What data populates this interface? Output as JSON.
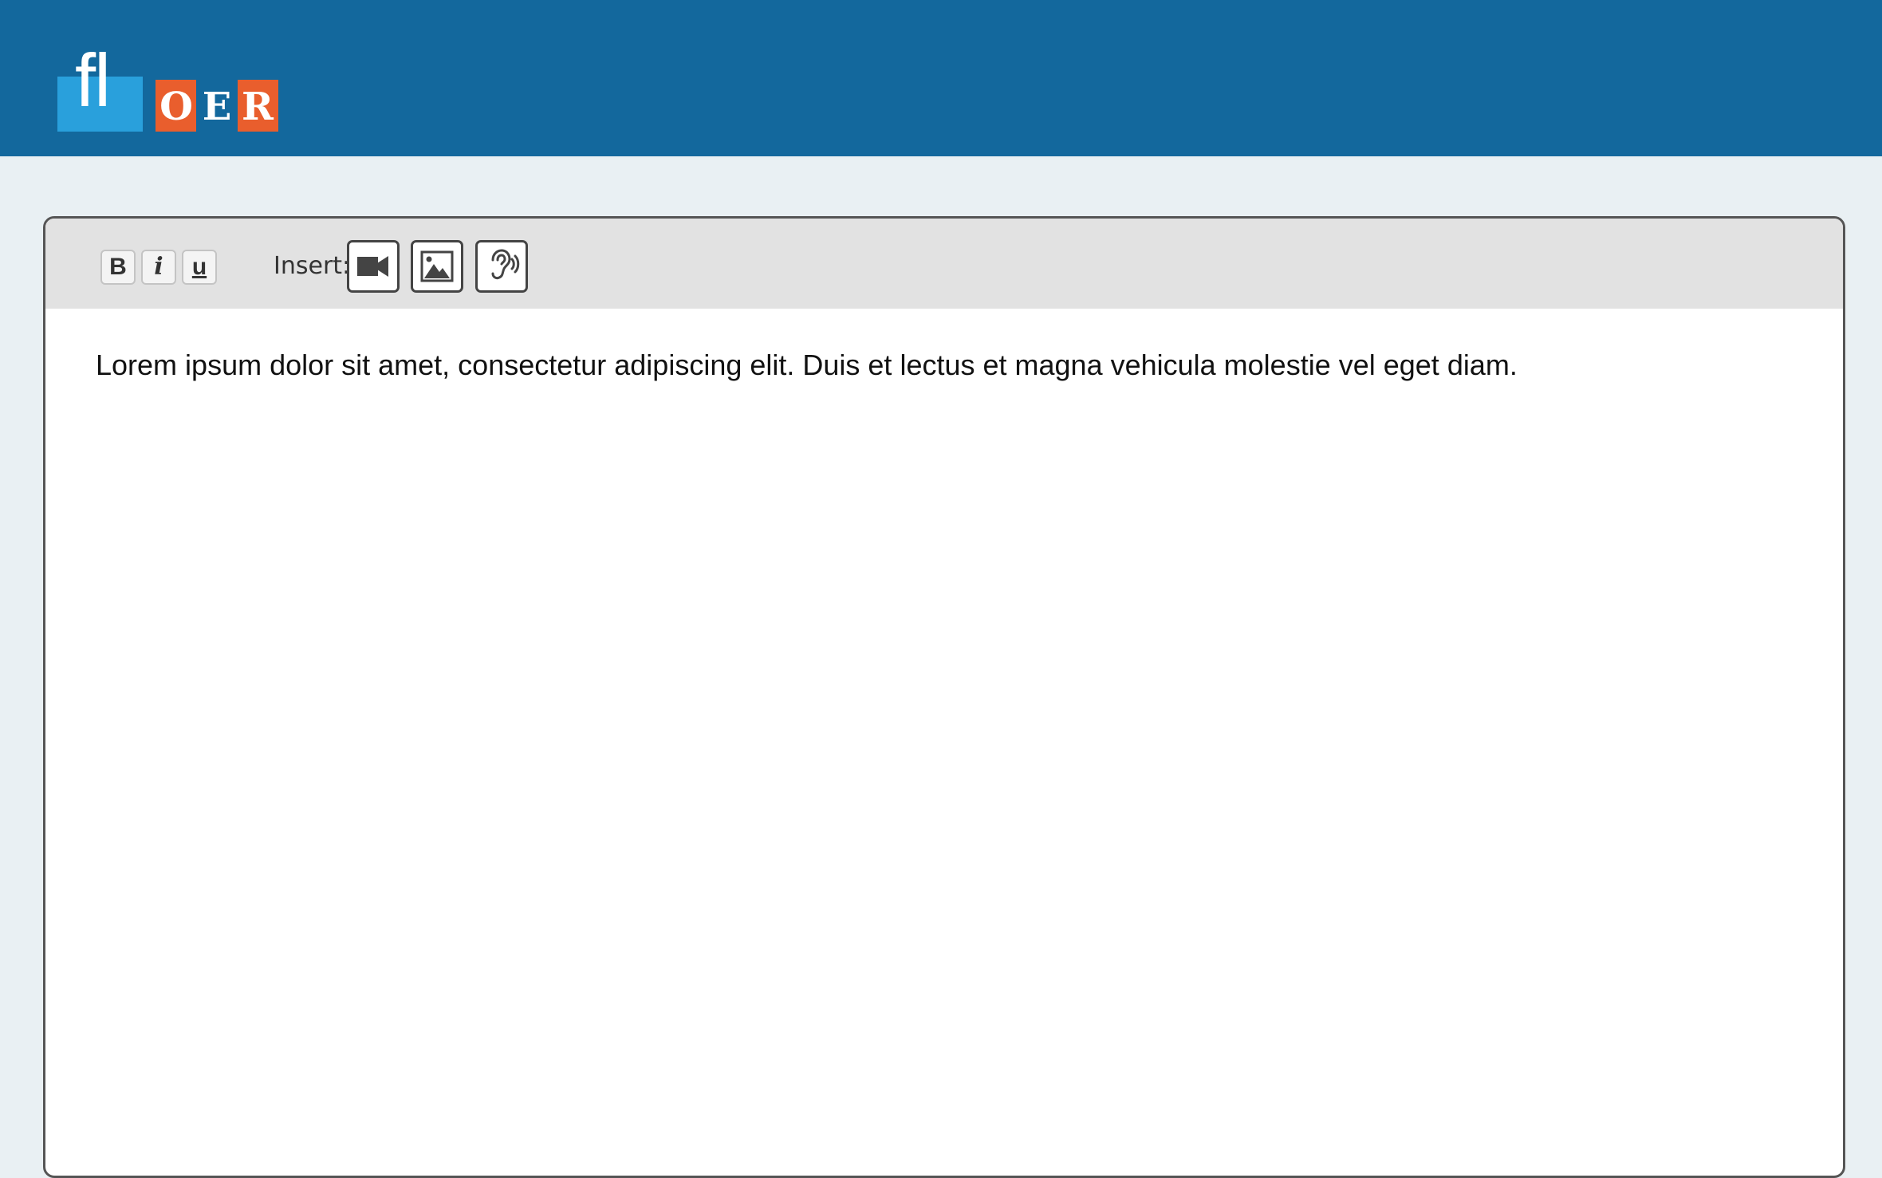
{
  "header": {
    "logo": {
      "fl": "fl",
      "oer_letters": [
        "O",
        "E",
        "R"
      ]
    },
    "background_color": "#13689d"
  },
  "editor": {
    "toolbar": {
      "bold_label": "B",
      "italic_label": "i",
      "underline_label": "u",
      "insert_label": "Insert:",
      "insert_buttons": [
        {
          "name": "video",
          "icon": "video-camera-icon"
        },
        {
          "name": "image",
          "icon": "image-icon"
        },
        {
          "name": "audio",
          "icon": "ear-audio-icon"
        }
      ]
    },
    "content_text": "Lorem ipsum dolor sit amet, consectetur adipiscing elit. Duis et lectus et magna vehicula molestie vel eget diam."
  },
  "colors": {
    "brand_blue": "#13689d",
    "logo_light_blue": "#29a0dc",
    "logo_orange": "#e95e2d",
    "page_background": "#e9f0f3",
    "toolbar_background": "#e2e2e2"
  }
}
